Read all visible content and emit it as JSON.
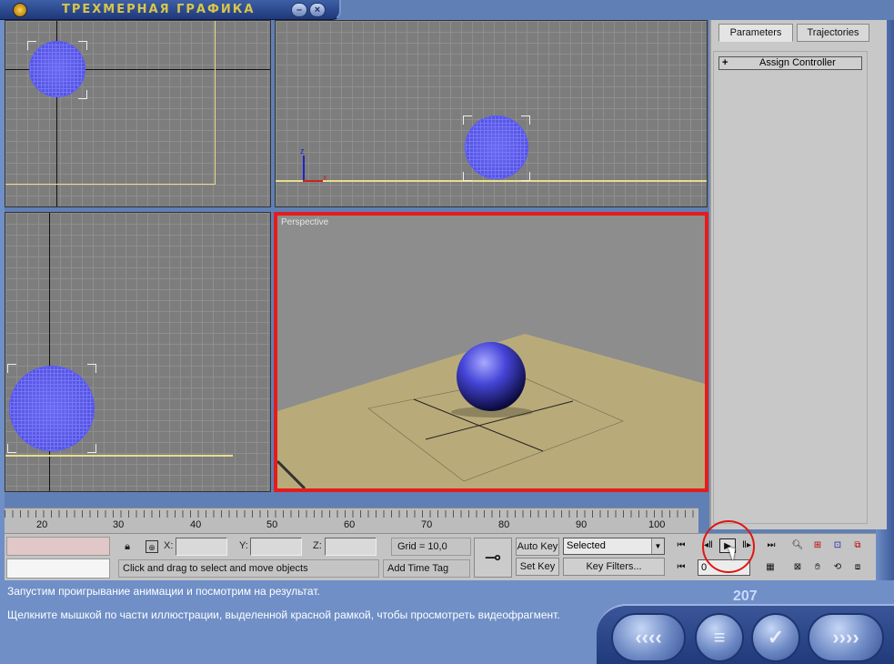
{
  "window": {
    "title": "ТРЕХМЕРНАЯ ГРАФИКА",
    "minimize_icon": "minimize-icon",
    "close_icon": "close-icon"
  },
  "viewports": {
    "perspective_label": "Perspective",
    "axis_z": "z",
    "axis_x": "x"
  },
  "command_panel": {
    "tabs": [
      {
        "label": "Parameters",
        "active": true
      },
      {
        "label": "Trajectories",
        "active": false
      }
    ],
    "rollout": {
      "expand": "+",
      "label": "Assign Controller"
    }
  },
  "timeline": {
    "ticks": [
      "20",
      "30",
      "40",
      "50",
      "60",
      "70",
      "80",
      "90",
      "100"
    ]
  },
  "toolbar": {
    "x_label": "X:",
    "y_label": "Y:",
    "z_label": "Z:",
    "x_value": "",
    "y_value": "",
    "z_value": "",
    "status": "Click and drag to select and move objects",
    "grid": "Grid = 10,0",
    "add_time_tag": "Add Time Tag",
    "key_icon": "key-icon",
    "auto_key": "Auto Key",
    "set_key": "Set Key",
    "selection_value": "Selected",
    "key_filters": "Key Filters...",
    "current_frame": "0",
    "playback_icons": [
      "go-to-start-icon",
      "previous-frame-icon",
      "play-icon",
      "next-frame-icon",
      "go-to-end-icon"
    ]
  },
  "info": {
    "line1": "Запустим проигрывание анимации и посмотрим на результат.",
    "line2": "Щелкните мышкой по части иллюстрации, выделенной красной рамкой, чтобы просмотреть видеофрагмент.",
    "page_number": "207",
    "nav": [
      "back-icon",
      "contents-icon",
      "check-icon",
      "forward-icon"
    ]
  },
  "colors": {
    "highlight": "#e51c1c",
    "sphere": "#4b4bd6",
    "panel": "#c8c8c8",
    "frame_blue": "#5f7fb5"
  }
}
